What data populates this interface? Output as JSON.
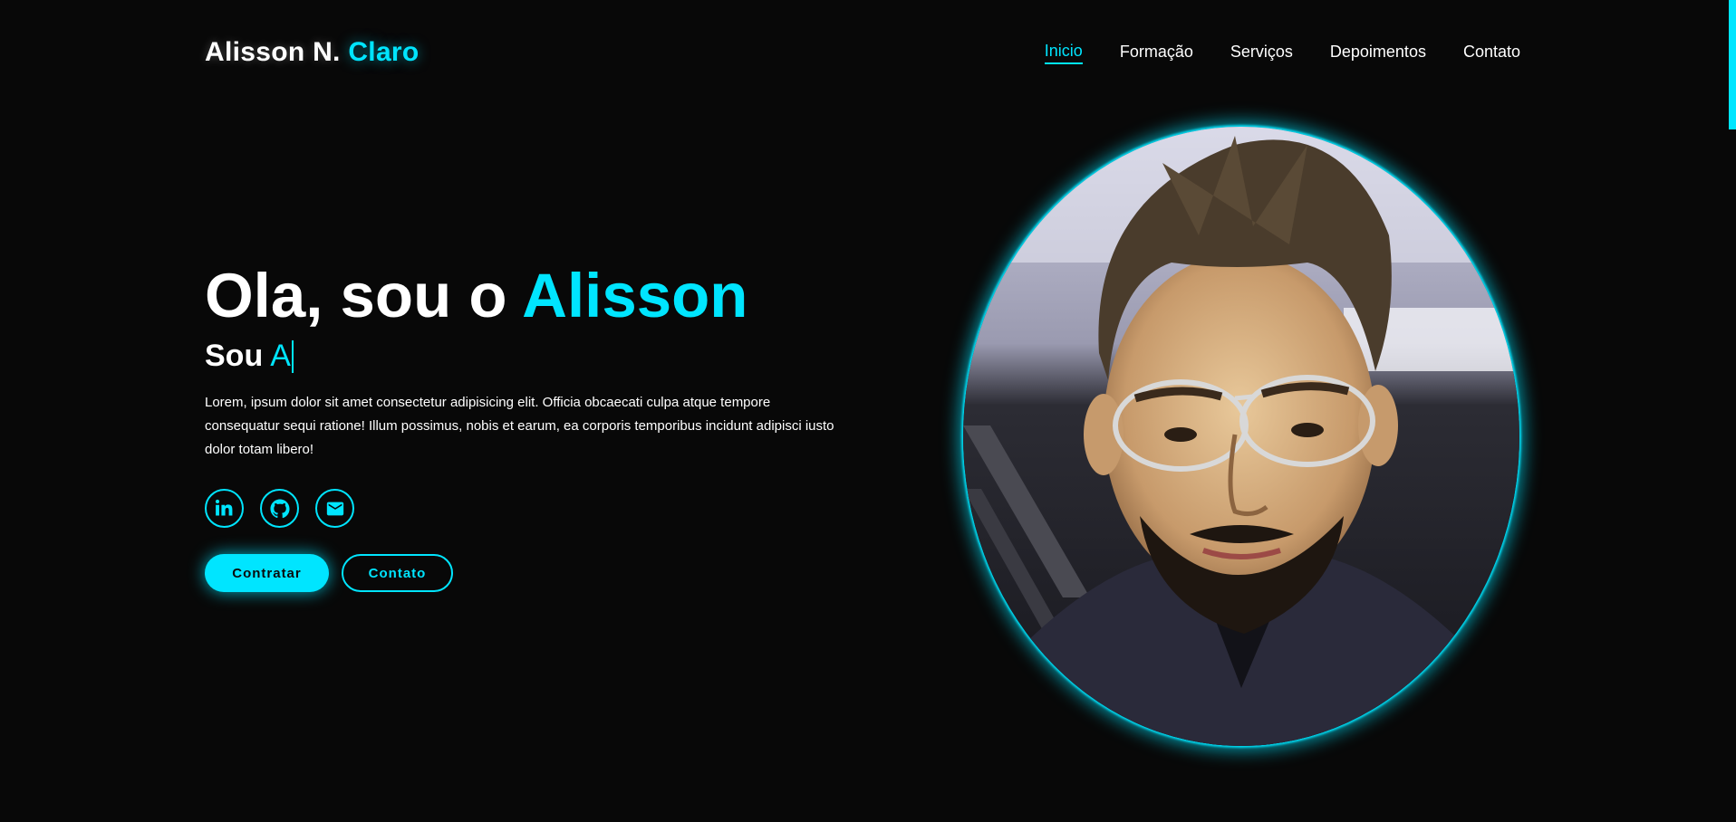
{
  "header": {
    "logo_main": "Alisson N.",
    "logo_accent": "Claro",
    "nav": [
      {
        "label": "Inicio",
        "active": true
      },
      {
        "label": "Formação",
        "active": false
      },
      {
        "label": "Serviços",
        "active": false
      },
      {
        "label": "Depoimentos",
        "active": false
      },
      {
        "label": "Contato",
        "active": false
      }
    ]
  },
  "hero": {
    "title_prefix": "Ola, sou o",
    "title_accent": "Alisson",
    "subtitle_prefix": "Sou",
    "subtitle_typed": "A",
    "description": "Lorem, ipsum dolor sit amet consectetur adipisicing elit. Officia obcaecati culpa atque tempore consequatur sequi ratione! Illum possimus, nobis et earum, ea corporis temporibus incidunt adipisci iusto dolor totam libero!",
    "socials": [
      {
        "icon": "linkedin-icon"
      },
      {
        "icon": "github-icon"
      },
      {
        "icon": "mail-icon"
      }
    ],
    "buttons": {
      "primary": "Contratar",
      "secondary": "Contato"
    }
  },
  "profile": {
    "image": "profile-photo"
  },
  "colors": {
    "background": "#080808",
    "accent": "#00e5ff",
    "text": "#ffffff"
  }
}
